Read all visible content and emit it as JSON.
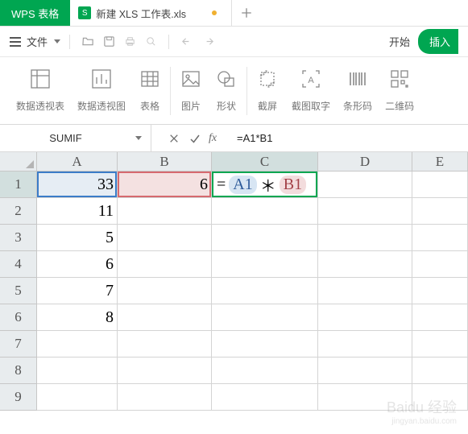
{
  "app_name": "WPS 表格",
  "doc": {
    "icon_text": "S",
    "title": "新建 XLS 工作表.xls",
    "dirty": true
  },
  "menu": {
    "file": "文件"
  },
  "ribbon_tabs": {
    "start": "开始",
    "insert": "插入"
  },
  "ribbon_groups": [
    {
      "label": "数据透视表"
    },
    {
      "label": "数据透视图"
    },
    {
      "label": "表格"
    },
    {
      "label": "图片"
    },
    {
      "label": "形状"
    },
    {
      "label": "截屏"
    },
    {
      "label": "截图取字"
    },
    {
      "label": "条形码"
    },
    {
      "label": "二维码"
    }
  ],
  "name_box": "SUMIF",
  "formula": "=A1*B1",
  "editing_cell": {
    "eq": "=",
    "ref1": "A1",
    "op": "＊",
    "ref2": "B1"
  },
  "columns": [
    "A",
    "B",
    "C",
    "D",
    "E"
  ],
  "rows": [
    "1",
    "2",
    "3",
    "4",
    "5",
    "6",
    "7",
    "8",
    "9"
  ],
  "data": {
    "A": [
      "33",
      "11",
      "5",
      "6",
      "7",
      "8",
      "",
      "",
      ""
    ],
    "B": [
      "6",
      "",
      "",
      "",
      "",
      "",
      "",
      "",
      ""
    ]
  },
  "watermark": {
    "main": "Baidu 经验",
    "sub": "jingyan.baidu.com"
  }
}
